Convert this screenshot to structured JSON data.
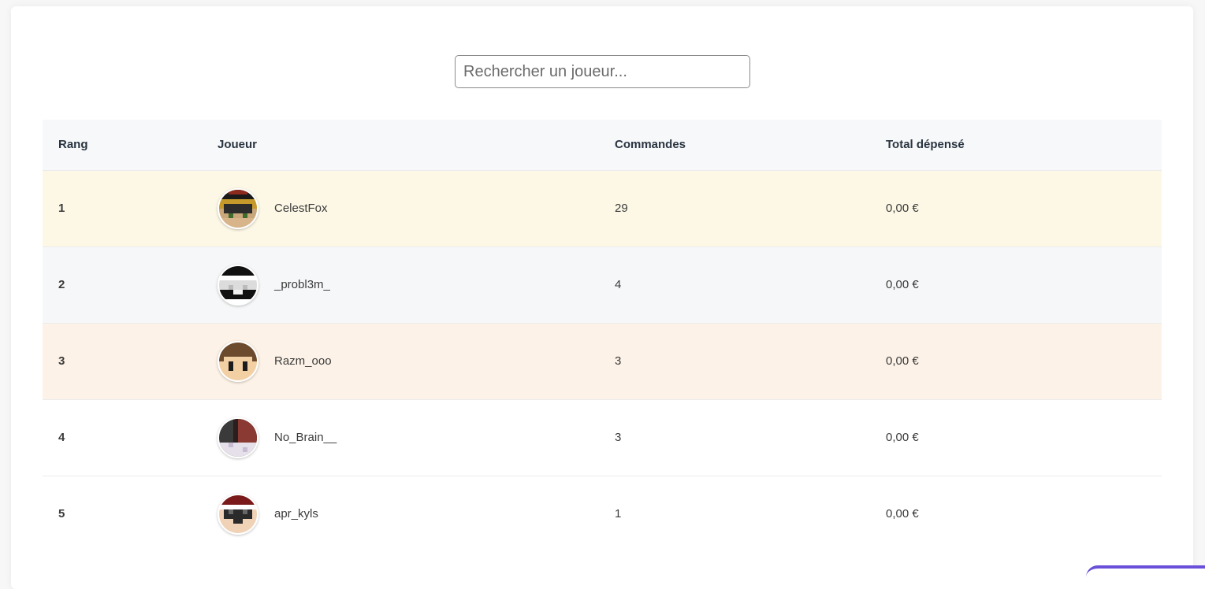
{
  "search": {
    "placeholder": "Rechercher un joueur..."
  },
  "table": {
    "headers": {
      "rank": "Rang",
      "player": "Joueur",
      "orders": "Commandes",
      "total": "Total dépensé"
    },
    "rows": [
      {
        "rank": "1",
        "player": "CelestFox",
        "orders": "29",
        "total": "0,00 €",
        "bg": "#fdf8e6"
      },
      {
        "rank": "2",
        "player": "_probl3m_",
        "orders": "4",
        "total": "0,00 €",
        "bg": "#f6f7f8"
      },
      {
        "rank": "3",
        "player": "Razm_ooo",
        "orders": "3",
        "total": "0,00 €",
        "bg": "#fcf2e7"
      },
      {
        "rank": "4",
        "player": "No_Brain__",
        "orders": "3",
        "total": "0,00 €",
        "bg": "#ffffff"
      },
      {
        "rank": "5",
        "player": "apr_kyls",
        "orders": "1",
        "total": "0,00 €",
        "bg": "#ffffff"
      }
    ]
  },
  "colors": {
    "accent": "#6a4fd8"
  }
}
